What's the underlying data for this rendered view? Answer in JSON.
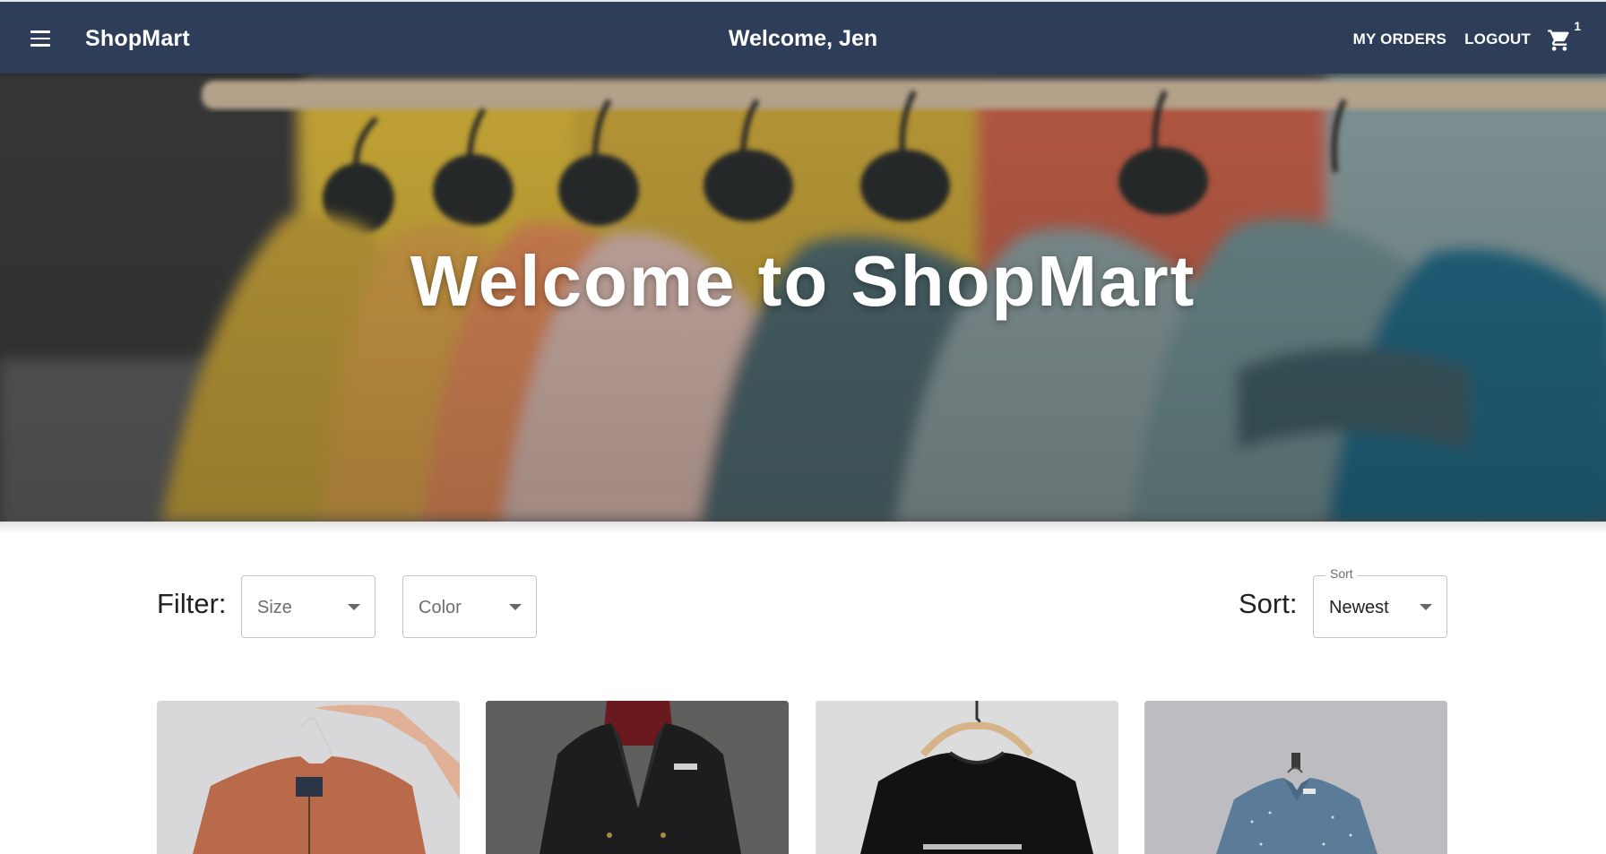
{
  "header": {
    "brand": "ShopMart",
    "welcome_text": "Welcome, Jen",
    "nav": [
      {
        "label": "MY ORDERS"
      },
      {
        "label": "LOGOUT"
      }
    ],
    "cart_count": "1",
    "bg_color": "#2e3e58"
  },
  "hero": {
    "title": "Welcome to ShopMart"
  },
  "filters": {
    "label": "Filter:",
    "size_placeholder": "Size",
    "color_placeholder": "Color"
  },
  "sort": {
    "label": "Sort:",
    "field_label": "Sort",
    "selected": "Newest"
  },
  "products": [
    {
      "image": "orange-bomber-jacket"
    },
    {
      "image": "black-double-breasted-blazer"
    },
    {
      "image": "black-sweatshirt-on-hanger"
    },
    {
      "image": "blue-patterned-shirt-on-hanger"
    }
  ]
}
